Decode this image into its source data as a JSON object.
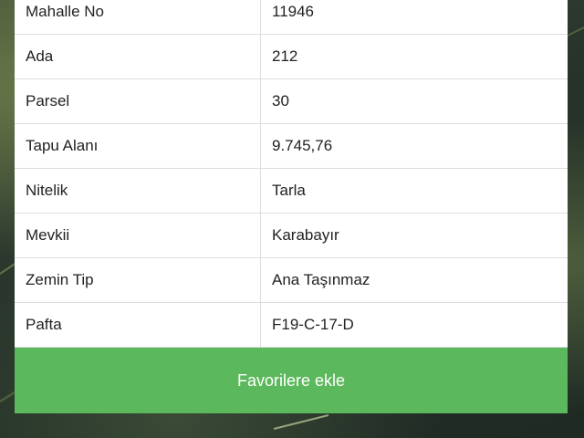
{
  "parcel_info": {
    "rows": [
      {
        "label": "Mahalle No",
        "value": "11946"
      },
      {
        "label": "Ada",
        "value": "212"
      },
      {
        "label": "Parsel",
        "value": "30"
      },
      {
        "label": "Tapu Alanı",
        "value": "9.745,76"
      },
      {
        "label": "Nitelik",
        "value": "Tarla"
      },
      {
        "label": "Mevkii",
        "value": "Karabayır"
      },
      {
        "label": "Zemin Tip",
        "value": "Ana Taşınmaz"
      },
      {
        "label": "Pafta",
        "value": "F19-C-17-D"
      }
    ]
  },
  "actions": {
    "favorite_label": "Favorilere ekle"
  },
  "colors": {
    "button": "#5cb85c",
    "map_background": "#26322a"
  }
}
